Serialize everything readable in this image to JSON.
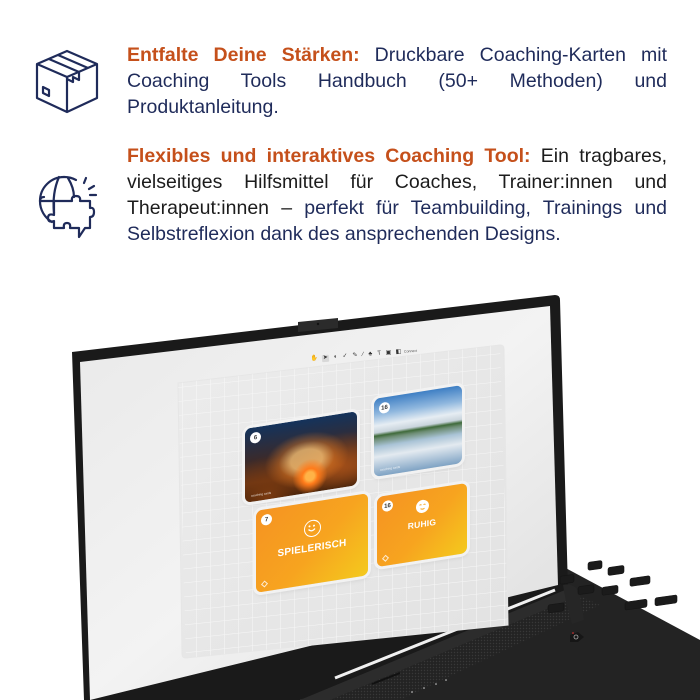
{
  "features": [
    {
      "icon": "package-box-icon",
      "heading": "Entfalte Deine Stärken:",
      "body": " Druckbare Coaching-Karten mit Coaching Tools Handbuch (50+ Methoden) und Produktanleitung."
    },
    {
      "icon": "globe-puzzle-speech-icon",
      "heading": "Flexibles und interaktives Coaching Tool:",
      "body_dark": " Ein tragbares, vielseitiges Hilfsmittel für Coaches, Trainer:innen und Therapeut:innen – ",
      "body_navy": "perfekt für Teambuilding, Trainings und Selbstreflexion dank des ansprechenden Designs."
    }
  ],
  "colors": {
    "heading": "#c5501b",
    "body_navy": "#1f2b5a",
    "body_dark": "#1c1c1c",
    "card_orange_start": "#f59322",
    "card_orange_end": "#f4c91e",
    "laptop_body": "#1e1e1e"
  },
  "board": {
    "toolbar": {
      "tools": [
        "hand-icon",
        "pointer-icon",
        "shape-icon",
        "check-icon",
        "pen-icon",
        "line-icon",
        "stamp-icon",
        "text-icon",
        "sticky-note-icon",
        "card-icon"
      ],
      "active_index": 1,
      "tool_glyphs": [
        "✋",
        "➤",
        "◐",
        "✓",
        "✎",
        "∕",
        "♣",
        "T",
        "▣",
        "◧"
      ],
      "last_label": "Connect"
    },
    "cards": [
      {
        "id": "card-fire",
        "number": "6",
        "type": "photo",
        "subject": "steel wool light painting in rocky cave",
        "brand": "coaching cards"
      },
      {
        "id": "card-lake",
        "number": "16",
        "type": "photo",
        "subject": "lake with cloud reflections",
        "brand": "coaching cards"
      },
      {
        "id": "card-spielerisch",
        "number": "7",
        "type": "emotion",
        "title": "SPIELERISCH",
        "icon": "smiley-icon"
      },
      {
        "id": "card-ruhig",
        "number": "16",
        "type": "emotion",
        "title": "RUHIG",
        "icon": "calm-face-icon"
      }
    ]
  }
}
